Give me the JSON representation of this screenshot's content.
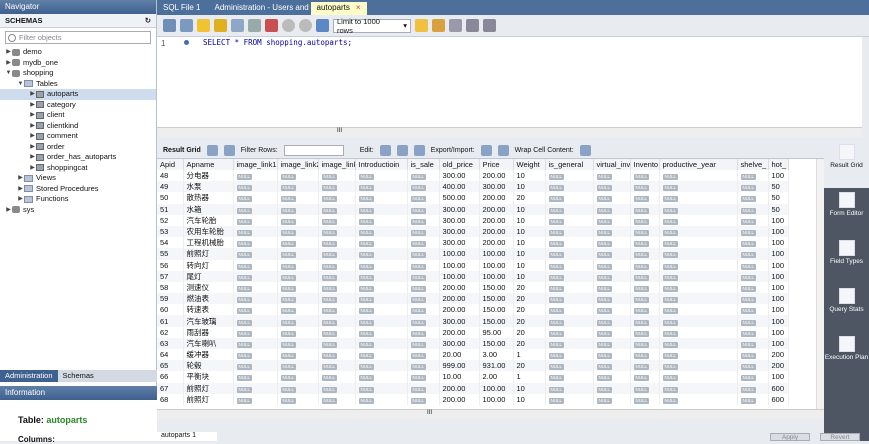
{
  "navigator": {
    "title": "Navigator",
    "schemas_label": "SCHEMAS",
    "filter_placeholder": "Filter objects",
    "tree": [
      {
        "label": "demo",
        "level": 0,
        "kind": "db",
        "toggle": "▶"
      },
      {
        "label": "mydb_one",
        "level": 0,
        "kind": "db",
        "toggle": "▶"
      },
      {
        "label": "shopping",
        "level": 0,
        "kind": "db",
        "toggle": "▼"
      },
      {
        "label": "Tables",
        "level": 1,
        "kind": "folder",
        "toggle": "▼"
      },
      {
        "label": "autoparts",
        "level": 2,
        "kind": "table",
        "toggle": "▶",
        "selected": true
      },
      {
        "label": "category",
        "level": 2,
        "kind": "table",
        "toggle": "▶"
      },
      {
        "label": "client",
        "level": 2,
        "kind": "table",
        "toggle": "▶"
      },
      {
        "label": "clientkind",
        "level": 2,
        "kind": "table",
        "toggle": "▶"
      },
      {
        "label": "comment",
        "level": 2,
        "kind": "table",
        "toggle": "▶"
      },
      {
        "label": "order",
        "level": 2,
        "kind": "table",
        "toggle": "▶"
      },
      {
        "label": "order_has_autoparts",
        "level": 2,
        "kind": "table",
        "toggle": "▶"
      },
      {
        "label": "shoppingcat",
        "level": 2,
        "kind": "table",
        "toggle": "▶"
      },
      {
        "label": "Views",
        "level": 1,
        "kind": "folder",
        "toggle": "▶"
      },
      {
        "label": "Stored Procedures",
        "level": 1,
        "kind": "folder",
        "toggle": "▶"
      },
      {
        "label": "Functions",
        "level": 1,
        "kind": "folder",
        "toggle": "▶"
      },
      {
        "label": "sys",
        "level": 0,
        "kind": "db",
        "toggle": "▶"
      }
    ],
    "tabs": [
      "Administration",
      "Schemas"
    ],
    "info_title": "Information",
    "info_table_label": "Table:",
    "info_table_name": "autoparts",
    "info_columns": "Columns:"
  },
  "tabs": [
    "SQL File 1",
    "Administration - Users and Privil...",
    "autoparts"
  ],
  "tab_close": "×",
  "toolbar": {
    "limit": "Limit to 1000 rows",
    "limit_arrow": "▾"
  },
  "editor": {
    "line": "1",
    "sql": "SELECT * FROM shopping.autoparts;"
  },
  "hscroll_mark": "III",
  "result_toolbar": {
    "result_grid": "Result Grid",
    "filter_rows": "Filter Rows:",
    "edit": "Edit:",
    "export": "Export/Import:",
    "wrap": "Wrap Cell Content:"
  },
  "side_buttons": [
    "Result Grid",
    "Form Editor",
    "Field Types",
    "Query Stats",
    "Execution Plan"
  ],
  "columns": [
    "Apid",
    "Apname",
    "image_link1",
    "image_link2",
    "image_link",
    "Introductioin",
    "is_sale",
    "old_price",
    "Price",
    "Weight",
    "is_general",
    "virtual_inve",
    "Invento",
    "productive_year",
    "shelve_",
    "hot_"
  ],
  "null_label": "NULL",
  "rows": [
    [
      "48",
      "分电器",
      "300.00",
      "200.00",
      "10",
      "100"
    ],
    [
      "49",
      "水泵",
      "400.00",
      "300.00",
      "10",
      "50"
    ],
    [
      "50",
      "散热器",
      "500.00",
      "200.00",
      "20",
      "50"
    ],
    [
      "51",
      "水箱",
      "300.00",
      "200.00",
      "10",
      "50"
    ],
    [
      "52",
      "汽车轮胎",
      "300.00",
      "200.00",
      "10",
      "100"
    ],
    [
      "53",
      "农用车轮胎",
      "300.00",
      "200.00",
      "10",
      "100"
    ],
    [
      "54",
      "工程机械胎",
      "300.00",
      "200.00",
      "10",
      "100"
    ],
    [
      "55",
      "前照灯",
      "100.00",
      "100.00",
      "10",
      "100"
    ],
    [
      "56",
      "转向灯",
      "100.00",
      "100.00",
      "10",
      "100"
    ],
    [
      "57",
      "尾灯",
      "100.00",
      "100.00",
      "10",
      "100"
    ],
    [
      "58",
      "测速仪",
      "200.00",
      "150.00",
      "20",
      "100"
    ],
    [
      "59",
      "燃油表",
      "200.00",
      "150.00",
      "20",
      "100"
    ],
    [
      "60",
      "转速表",
      "200.00",
      "150.00",
      "20",
      "100"
    ],
    [
      "61",
      "汽车玻璃",
      "300.00",
      "150.00",
      "20",
      "100"
    ],
    [
      "62",
      "雨刮器",
      "200.00",
      "95.00",
      "20",
      "100"
    ],
    [
      "63",
      "汽车喇叭",
      "300.00",
      "150.00",
      "20",
      "100"
    ],
    [
      "64",
      "缓冲器",
      "20.00",
      "3.00",
      "1",
      "200"
    ],
    [
      "65",
      "轮毂",
      "999.00",
      "931.00",
      "20",
      "200"
    ],
    [
      "66",
      "平衡块",
      "10.00",
      "2.00",
      "1",
      "100"
    ],
    [
      "67",
      "前照灯",
      "200.00",
      "100.00",
      "10",
      "600"
    ],
    [
      "68",
      "前照灯",
      "200.00",
      "100.00",
      "10",
      "600"
    ]
  ],
  "result_tab": "autoparts 1",
  "apply_label": "Apply",
  "revert_label": "Revert"
}
